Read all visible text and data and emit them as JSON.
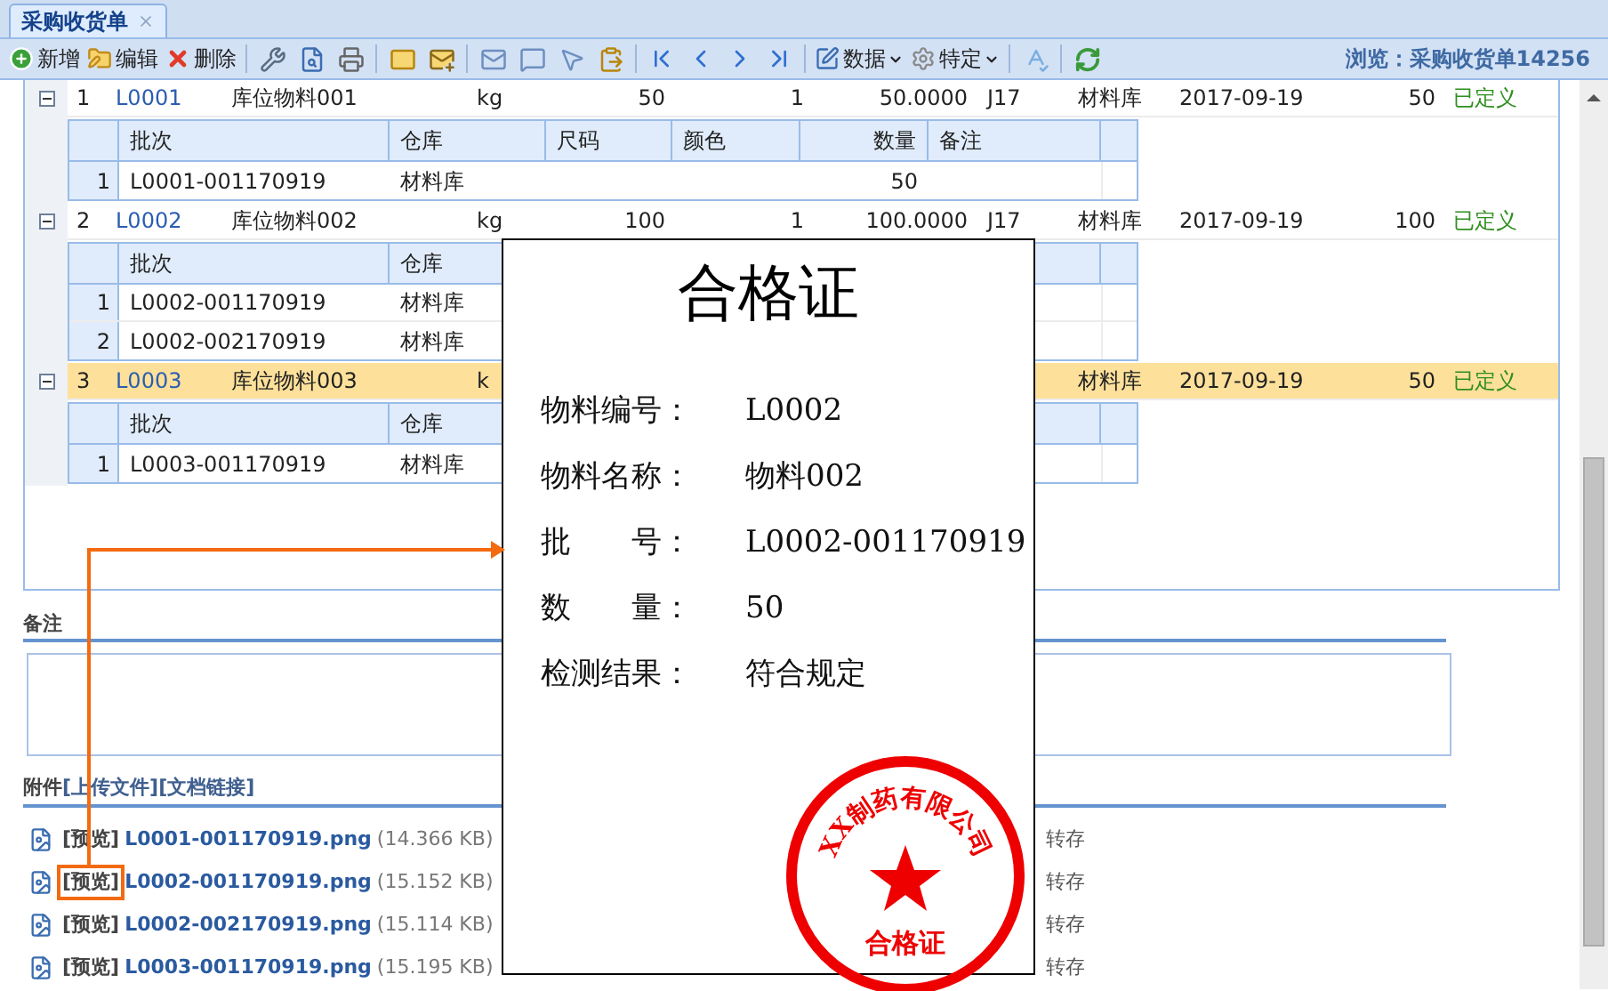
{
  "tab": {
    "title": "采购收货单",
    "selected": true
  },
  "toolbar": {
    "buttons": [
      {
        "kind": "add",
        "label": "新增"
      },
      {
        "kind": "edit",
        "label": "编辑"
      },
      {
        "kind": "delete",
        "label": "删除"
      }
    ],
    "menus": [
      {
        "kind": "data",
        "label": "数据"
      },
      {
        "kind": "special",
        "label": "特定"
      }
    ],
    "status": "浏览：采购收货单14256"
  },
  "grid": {
    "rows": [
      {
        "index": "1",
        "code": "L0001",
        "name": "库位物料001",
        "unit": "kg",
        "qty": "50",
        "col_6": "1",
        "price": "50.0000",
        "col_8": "J17",
        "warehouse": "材料库",
        "date": "2017-09-19",
        "received": "50",
        "status": "已定义",
        "expanded": true,
        "selected": false,
        "detail": {
          "columns": [
            "批次",
            "仓库",
            "尺码",
            "颜色",
            "数量",
            "备注"
          ],
          "rows": [
            {
              "index": "1",
              "cells": [
                "L0001-001170919",
                "材料库",
                "",
                "",
                "50",
                ""
              ]
            }
          ]
        }
      },
      {
        "index": "2",
        "code": "L0002",
        "name": "库位物料002",
        "unit": "kg",
        "qty": "100",
        "col_6": "1",
        "price": "100.0000",
        "col_8": "J17",
        "warehouse": "材料库",
        "date": "2017-09-19",
        "received": "100",
        "status": "已定义",
        "expanded": true,
        "selected": false,
        "detail": {
          "columns": [
            "批次",
            "仓库"
          ],
          "rows": [
            {
              "index": "1",
              "cells": [
                "L0002-001170919",
                "材料库"
              ]
            },
            {
              "index": "2",
              "cells": [
                "L0002-002170919",
                "材料库"
              ]
            }
          ]
        }
      },
      {
        "index": "3",
        "code": "L0003",
        "name": "库位物料003",
        "unit": "k",
        "warehouse": "材料库",
        "date": "2017-09-19",
        "received": "50",
        "status": "已定义",
        "expanded": true,
        "selected": true,
        "detail": {
          "columns": [
            "批次",
            "仓库"
          ],
          "rows": [
            {
              "index": "1",
              "cells": [
                "L0003-001170919",
                "材料库"
              ]
            }
          ]
        }
      }
    ]
  },
  "remarks": {
    "label": "备注"
  },
  "attachments": {
    "label": "附件",
    "links": [
      "[上传文件]",
      "[文档链接]"
    ],
    "items": [
      {
        "preview": "[预览]",
        "filename": "L0001-001170919.png",
        "size": "(14.366 KB)",
        "action": "转存",
        "highlighted": false
      },
      {
        "preview": "[预览]",
        "filename": "L0002-001170919.png",
        "size": "(15.152 KB)",
        "action": "转存",
        "highlighted": true
      },
      {
        "preview": "[预览]",
        "filename": "L0002-002170919.png",
        "size": "(15.114 KB)",
        "action": "转存",
        "highlighted": false
      },
      {
        "preview": "[预览]",
        "filename": "L0003-001170919.png",
        "size": "(15.195 KB)",
        "action": "转存",
        "highlighted": false
      }
    ]
  },
  "certificate": {
    "title": "合格证",
    "fields": [
      {
        "label": "物料编号：",
        "value": "L0002"
      },
      {
        "label": "物料名称：",
        "value": "物料002"
      },
      {
        "label": "批　　号：",
        "value": "L0002-001170919"
      },
      {
        "label": "数　　量：",
        "value": "50"
      },
      {
        "label": "检测结果：",
        "value": "符合规定"
      }
    ],
    "stamp": {
      "company": "XX制药有限公司",
      "caption": "合格证"
    }
  }
}
